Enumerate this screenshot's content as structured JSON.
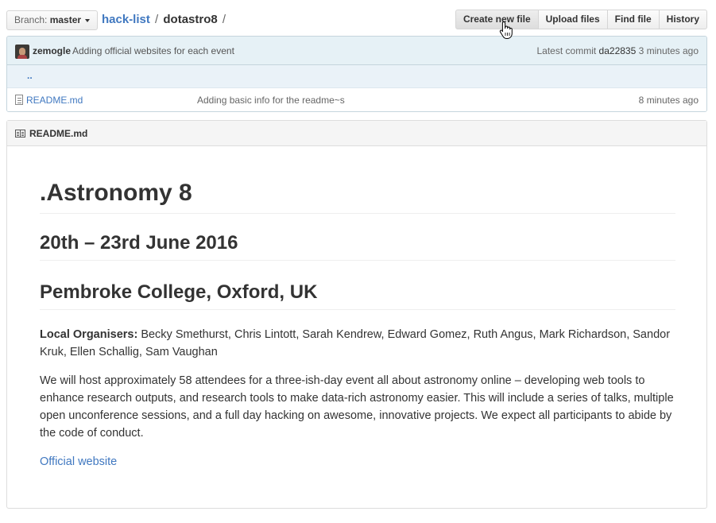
{
  "topbar": {
    "branch_label": "Branch:",
    "branch_value": "master",
    "repo": "hack-list",
    "separator": "/",
    "directory": "dotastro8",
    "trailing_separator": "/",
    "buttons": {
      "create": "Create new file",
      "upload": "Upload files",
      "find": "Find file",
      "history": "History"
    }
  },
  "commit": {
    "author": "zemogle",
    "message": "Adding official websites for each event",
    "latest_label": "Latest commit",
    "sha": "da22835",
    "age": "3 minutes ago"
  },
  "files": {
    "parent_link": "..",
    "rows": [
      {
        "name": "README.md",
        "message": "Adding basic info for the readme~s",
        "age": "8 minutes ago"
      }
    ]
  },
  "readme": {
    "filename": "README.md",
    "h1": ".Astronomy 8",
    "h2_date": "20th – 23rd June 2016",
    "h2_place": "Pembroke College, Oxford, UK",
    "organisers_label": "Local Organisers:",
    "organisers": " Becky Smethurst, Chris Lintott, Sarah Kendrew, Edward Gomez, Ruth Angus, Mark Richardson, Sandor Kruk, Ellen Schallig, Sam Vaughan",
    "description": "We will host approximately 58 attendees for a three-ish-day event all about astronomy online – developing web tools to enhance research outputs, and research tools to make data-rich astronomy easier. This will include a series of talks, multiple open unconference sessions, and a full day hacking on awesome, innovative projects. We expect all participants to abide by the code of conduct.",
    "link_text": "Official website"
  }
}
